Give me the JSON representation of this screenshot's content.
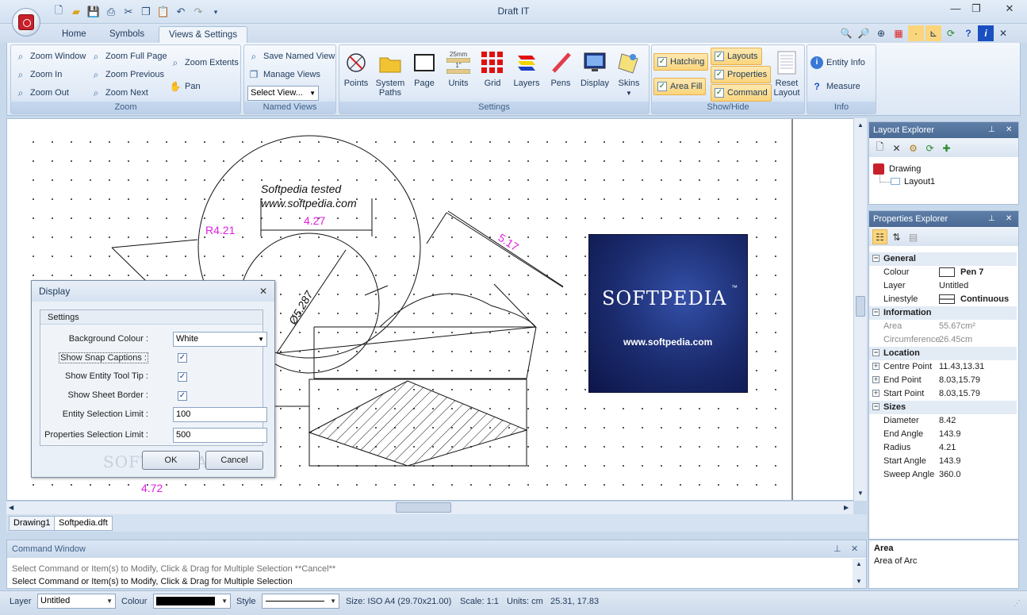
{
  "window": {
    "title": "Draft IT"
  },
  "ribbon_tabs": [
    "Home",
    "Symbols",
    "Views & Settings"
  ],
  "zoom_group": {
    "caption": "Zoom",
    "items": [
      "Zoom Window",
      "Zoom In",
      "Zoom Out",
      "Zoom Full Page",
      "Zoom Previous",
      "Zoom Next",
      "Zoom Extents",
      "Pan"
    ]
  },
  "named_views_group": {
    "caption": "Named Views",
    "save": "Save Named View",
    "manage": "Manage Views",
    "select": "Select View..."
  },
  "settings_group": {
    "caption": "Settings",
    "items": [
      "Points",
      "System",
      "Page",
      "Units",
      "Grid",
      "Layers",
      "Pens",
      "Display",
      "Skins"
    ],
    "system_line2": "Paths",
    "units_top": "25mm",
    "units_small": "1\""
  },
  "showhide_group": {
    "caption": "Show/Hide",
    "checks": [
      "Hatching",
      "Area Fill",
      "Layouts",
      "Properties",
      "Command"
    ],
    "reset_line1": "Reset",
    "reset_line2": "Layout"
  },
  "info_group": {
    "caption": "Info",
    "items": [
      "Entity Info",
      "Measure"
    ]
  },
  "drawing": {
    "text1": "Softpedia tested",
    "text2": "www.softpedia.com",
    "dim_radius": "R4.21",
    "dim_width": "4.27",
    "dim_diameter": "Ø5.287",
    "dim_angled": "5.17",
    "dim_bottom": "4.72",
    "logo_text": "SOFTPEDIA",
    "logo_tm": "™",
    "logo_url": "www.softpedia.com",
    "watermark": "SOFTPEDIA"
  },
  "doc_tabs": [
    "Drawing1",
    "Softpedia.dft"
  ],
  "command_window": {
    "title": "Command Window",
    "line1": "Select Command or Item(s) to Modify, Click & Drag for Multiple Selection  **Cancel**",
    "line2": "Select Command or Item(s) to Modify, Click & Drag for Multiple Selection"
  },
  "layout_explorer": {
    "title": "Layout Explorer",
    "root": "Drawing",
    "child": "Layout1"
  },
  "properties_explorer": {
    "title": "Properties Explorer",
    "rows": [
      {
        "type": "cat",
        "k": "General"
      },
      {
        "type": "row",
        "k": "Colour",
        "v": "Pen 7"
      },
      {
        "type": "row",
        "k": "Layer",
        "v": "Untitled"
      },
      {
        "type": "row",
        "k": "Linestyle",
        "v": "Continuous"
      },
      {
        "type": "cat",
        "k": "Information"
      },
      {
        "type": "gray",
        "k": "Area",
        "v": "55.67cm²"
      },
      {
        "type": "gray",
        "k": "Circumference",
        "v": "26.45cm"
      },
      {
        "type": "cat",
        "k": "Location"
      },
      {
        "type": "exp",
        "k": "Centre Point",
        "v": "11.43,13.31"
      },
      {
        "type": "exp",
        "k": "End Point",
        "v": "8.03,15.79"
      },
      {
        "type": "exp",
        "k": "Start Point",
        "v": "8.03,15.79"
      },
      {
        "type": "cat",
        "k": "Sizes"
      },
      {
        "type": "row",
        "k": "Diameter",
        "v": "8.42"
      },
      {
        "type": "row",
        "k": "End Angle",
        "v": "143.9"
      },
      {
        "type": "row",
        "k": "Radius",
        "v": "4.21"
      },
      {
        "type": "row",
        "k": "Start Angle",
        "v": "143.9"
      },
      {
        "type": "row",
        "k": "Sweep Angle",
        "v": "360.0"
      }
    ],
    "desc_title": "Area",
    "desc_text": "Area of Arc"
  },
  "statusbar": {
    "layer_label": "Layer",
    "layer_value": "Untitled",
    "colour_label": "Colour",
    "style_label": "Style",
    "size": "Size: ISO A4 (29.70x21.00)",
    "scale": "Scale: 1:1",
    "units": "Units: cm",
    "coords": "25.31, 17.83"
  },
  "display_dialog": {
    "title": "Display",
    "frame_title": "Settings",
    "background_label": "Background Colour :",
    "background_value": "White",
    "snap_label": "Show Snap Captions :",
    "tooltip_label": "Show Entity Tool Tip :",
    "border_label": "Show Sheet Border :",
    "entity_limit_label": "Entity Selection Limit :",
    "entity_limit_value": "100",
    "props_limit_label": "Properties Selection Limit :",
    "props_limit_value": "500",
    "ok": "OK",
    "cancel": "Cancel"
  },
  "colors": {
    "accent": "#c8202a",
    "dimension": "#e020e0",
    "panel_header": "#4b6b95",
    "logo_bg": "#1a2a6c"
  }
}
